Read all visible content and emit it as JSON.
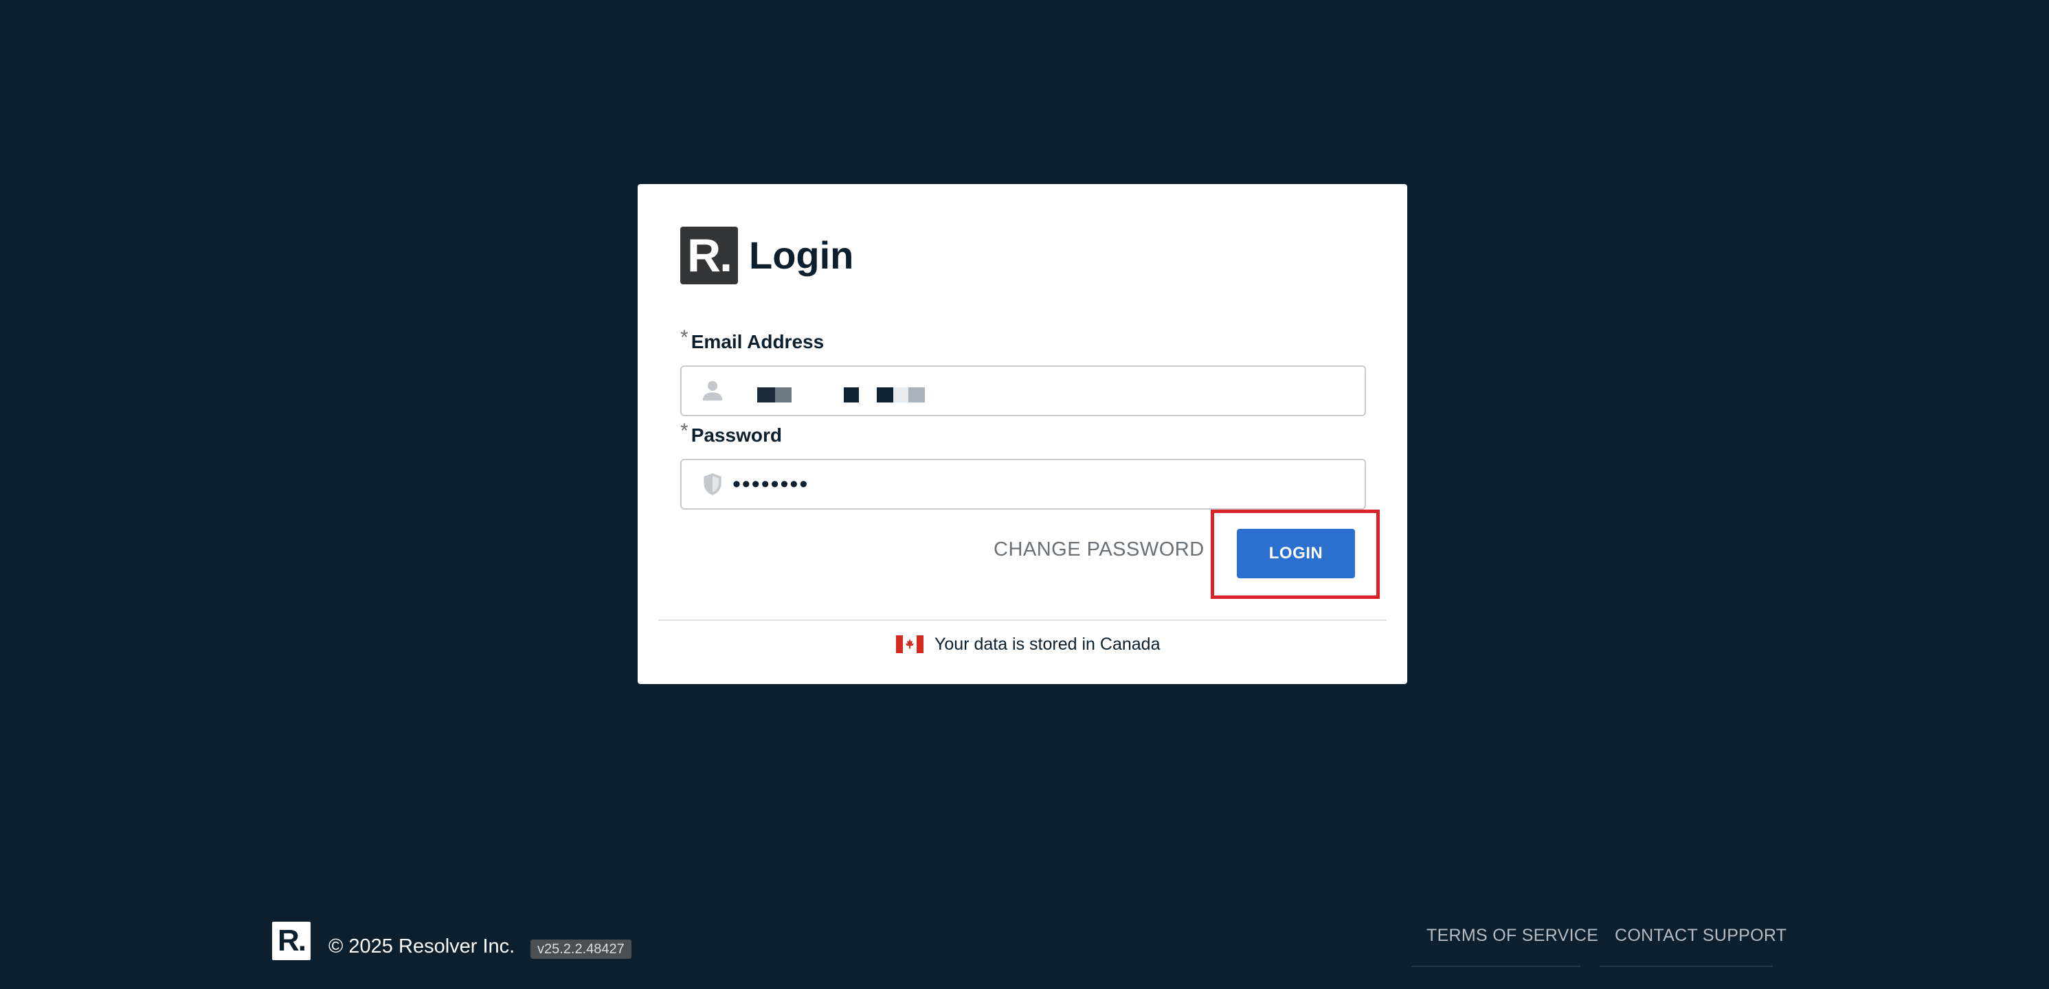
{
  "brand": {
    "mark": "R."
  },
  "login": {
    "title": "Login",
    "email": {
      "label": "Email Address",
      "required_marker": "*",
      "icon": "user-icon",
      "value": ""
    },
    "password": {
      "label": "Password",
      "required_marker": "*",
      "icon": "shield-icon",
      "value": "••••••••"
    },
    "change_password_label": "CHANGE PASSWORD",
    "login_label": "LOGIN",
    "data_note": "Your data is stored in Canada",
    "data_note_icon": "canada-flag-icon"
  },
  "footer": {
    "logo": "R.",
    "copyright": "© 2025 Resolver Inc.",
    "version": "v25.2.2.48427",
    "links": [
      "TERMS OF SERVICE",
      "CONTACT SUPPORT"
    ]
  },
  "colors": {
    "background": "#0b1f2e",
    "primary_button": "#2b6fcf",
    "highlight": "#d8232a",
    "flag_red": "#d52b1e"
  }
}
